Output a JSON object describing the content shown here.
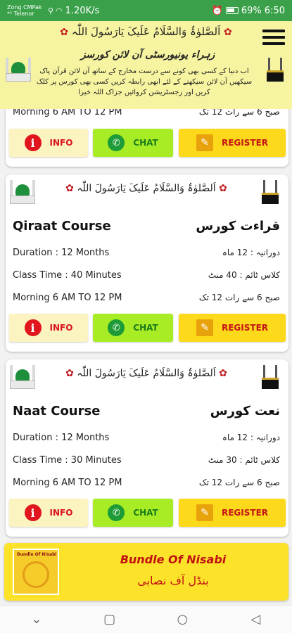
{
  "status_bar": {
    "carrier": "Zong CMPak ⁴ᴳ Telenor",
    "speed": "1.20K/s",
    "battery": "69%",
    "time": "6:50"
  },
  "header": {
    "salawat": "اَلصَّلوٰۃُ وَالسَّلَامُ عَلَیکَ یَارَسُولَ اللّٰہ",
    "title": "زہراء یونیورسٹی آن لائن کورسز",
    "description": "اب دنیا کے کسی بھی کونے سے درست مخارج کے ساتھ آن لائن قرآن پاک سیکھیں آن لائن سیکھنے کے لئے ابھی رابطہ کریں کسی بھی کورس پر کلک کریں اور رجسٹریشن کروائیں جزاک اللہ خیرا"
  },
  "buttons": {
    "info": "INFO",
    "chat": "CHAT",
    "register": "REGISTER"
  },
  "partial_card": {
    "timing_en": "Morning 6 AM TO 12 PM",
    "timing_ur": "صبح 6 سے رات 12 تک"
  },
  "courses": [
    {
      "salawat": "اَلصَّلوٰۃُ وَالسَّلَامُ عَلَیکَ یَارَسُولَ اللّٰہ",
      "name_en": "Qiraat Course",
      "name_ur": "قراءت کورس",
      "duration_en": "Duration : 12 Months",
      "duration_ur": "دورانیہ : 12 ماہ",
      "class_time_en": "Class Time : 40 Minutes",
      "class_time_ur": "کلاس ٹائم : 40 منٹ",
      "timing_en": "Morning 6 AM TO 12 PM",
      "timing_ur": "صبح 6 سے رات 12 تک"
    },
    {
      "salawat": "اَلصَّلوٰۃُ وَالسَّلَامُ عَلَیکَ یَارَسُولَ اللّٰہ",
      "name_en": "Naat Course",
      "name_ur": "نعت کورس",
      "duration_en": "Duration : 12 Months",
      "duration_ur": "دورانیہ : 12 ماہ",
      "class_time_en": "Class Time : 30 Minutes",
      "class_time_ur": "کلاس ٹائم : 30 منٹ",
      "timing_en": "Morning 6 AM TO 12 PM",
      "timing_ur": "صبح 6 سے رات 12 تک"
    }
  ],
  "bundle": {
    "logo_text": "Bundle Of Nisabi",
    "title_en": "Bundle Of Nisabi",
    "title_ur": "بنڈل آف نصابی"
  },
  "icons": {
    "menu": "hamburger-menu-icon",
    "info": "info-icon",
    "chat": "whatsapp-icon",
    "register": "register-form-icon"
  },
  "colors": {
    "status_bar": "#3aa14a",
    "header_bg": "#f6f4a0",
    "info_btn": "#fbf3c0",
    "chat_btn": "#a8ec26",
    "register_btn": "#fcd91a"
  }
}
